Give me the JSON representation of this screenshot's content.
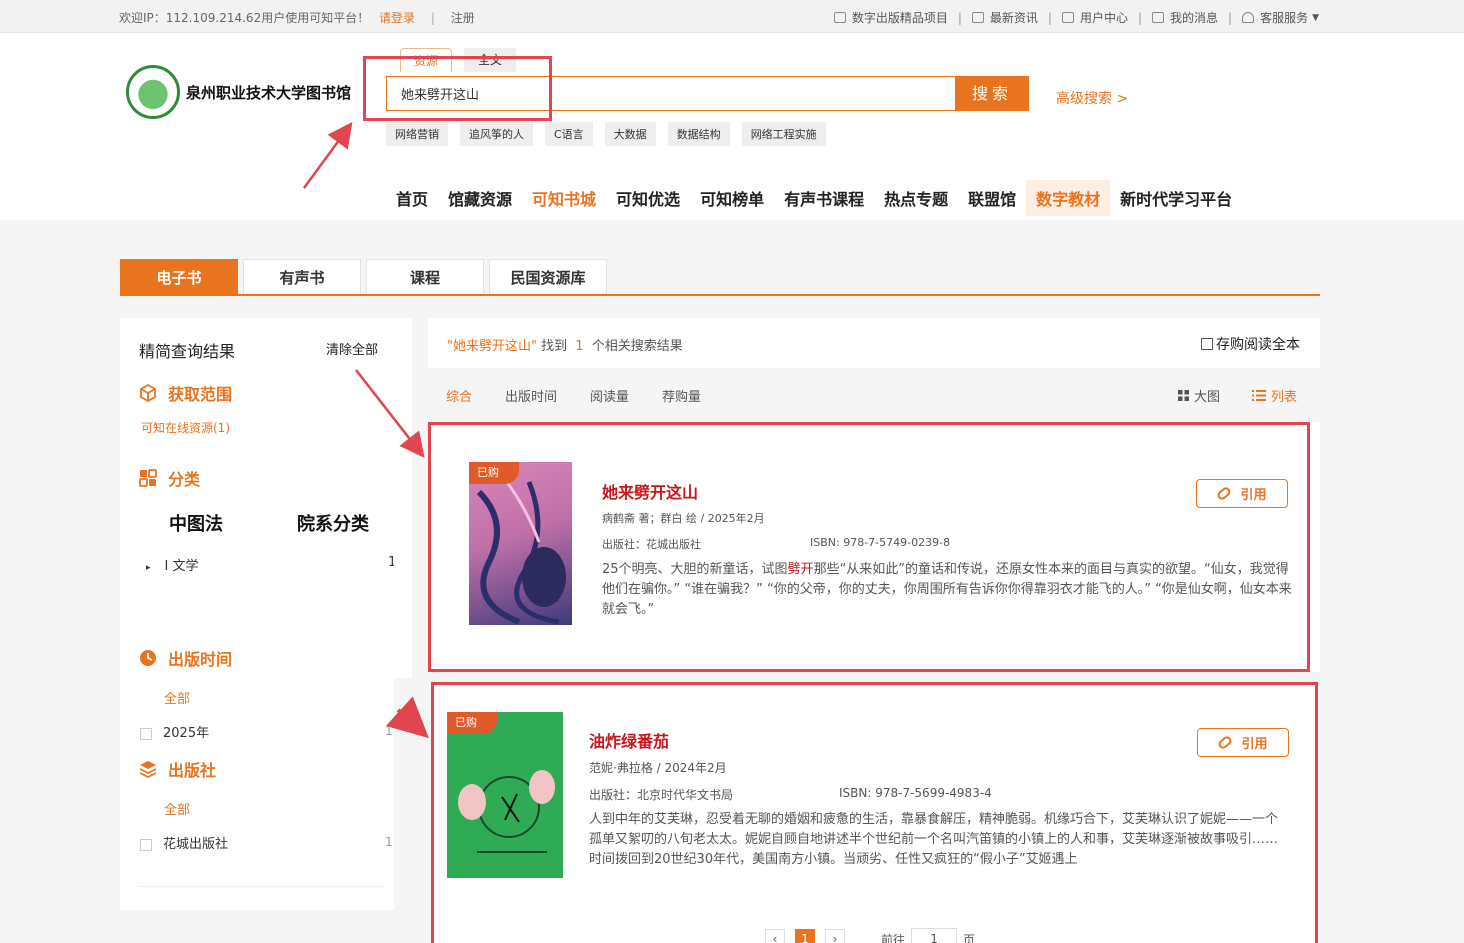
{
  "topbar": {
    "welcome": "欢迎IP：112.109.214.62用户使用可知平台！",
    "login": "请登录",
    "register": "注册",
    "links": [
      "数字出版精品项目",
      "最新资讯",
      "用户中心",
      "我的消息",
      "客服服务"
    ]
  },
  "logo": {
    "text": "泉州职业技术大学图书馆"
  },
  "search": {
    "tabs": [
      "资源",
      "全文"
    ],
    "value": "她来劈开这山",
    "button": "搜索",
    "advanced": "高级搜索 >",
    "hot_tags": [
      "网络营销",
      "追风筝的人",
      "C语言",
      "大数据",
      "数据结构",
      "网络工程实施"
    ]
  },
  "nav": [
    "首页",
    "馆藏资源",
    "可知书城",
    "可知优选",
    "可知榜单",
    "有声书课程",
    "热点专题",
    "联盟馆",
    "数字教材",
    "新时代学习平台"
  ],
  "category_tabs": [
    "电子书",
    "有声书",
    "课程",
    "民国资源库"
  ],
  "sidebar": {
    "title": "精简查询结果",
    "clear": "清除全部",
    "scope": {
      "label": "获取范围",
      "item": "可知在线资源(1)"
    },
    "classify": {
      "label": "分类",
      "col1": "中图法",
      "col2": "院系分类",
      "row_label": "I 文学",
      "row_count": "1"
    },
    "pubtime": {
      "label": "出版时间",
      "all": "全部",
      "row_label": "2025年",
      "row_count": "1"
    },
    "publisher": {
      "label": "出版社",
      "all": "全部",
      "row_label": "花城出版社",
      "row_count": "1"
    }
  },
  "results": {
    "keyword": "\"她来劈开这山\"",
    "found": "找到",
    "count": "1",
    "suffix": "个相关搜索结果",
    "buy_all": "存购阅读全本",
    "sort": [
      "综合",
      "出版时间",
      "阅读量",
      "荐购量"
    ],
    "view": [
      "大图",
      "列表"
    ]
  },
  "books": [
    {
      "badge": "已购",
      "title": "她来劈开这山",
      "author": "病鹤斋 著；群白 绘 / 2025年2月",
      "publisher": "出版社：花城出版社",
      "isbn": "ISBN: 978-7-5749-0239-8",
      "desc_pre": "25个明亮、大胆的新童话，试图",
      "desc_hl": "劈开",
      "desc_post": "那些“从来如此”的童话和传说，还原女性本来的面目与真实的欲望。“仙女，我觉得他们在骗你。” “谁在骗我？” “你的父帝，你的丈夫，你周围所有告诉你你得靠羽衣才能飞的人。” “你是仙女啊，仙女本来就会飞。”",
      "cite": "引用"
    },
    {
      "badge": "已购",
      "title": "油炸绿番茄",
      "author": "范妮·弗拉格 / 2024年2月",
      "publisher": "出版社：北京时代华文书局",
      "isbn": "ISBN: 978-7-5699-4983-4",
      "desc": "人到中年的艾芙琳，忍受着无聊的婚姻和疲惫的生活，靠暴食解压，精神脆弱。机缘巧合下，艾芙琳认识了妮妮——一个孤单又絮叨的八旬老太太。妮妮自顾自地讲述半个世纪前一个名叫汽笛镇的小镇上的人和事，艾芙琳逐渐被故事吸引…… 时间拨回到20世纪30年代，美国南方小镇。当顽劣、任性又疯狂的“假小子”艾姬遇上",
      "cite": "引用"
    }
  ],
  "pager": {
    "current": "1",
    "goto": "前往",
    "input": "1",
    "page": "页"
  },
  "colors": {
    "accent": "#e8741f",
    "title_red": "#c8161d",
    "annotation": "#e04550"
  }
}
